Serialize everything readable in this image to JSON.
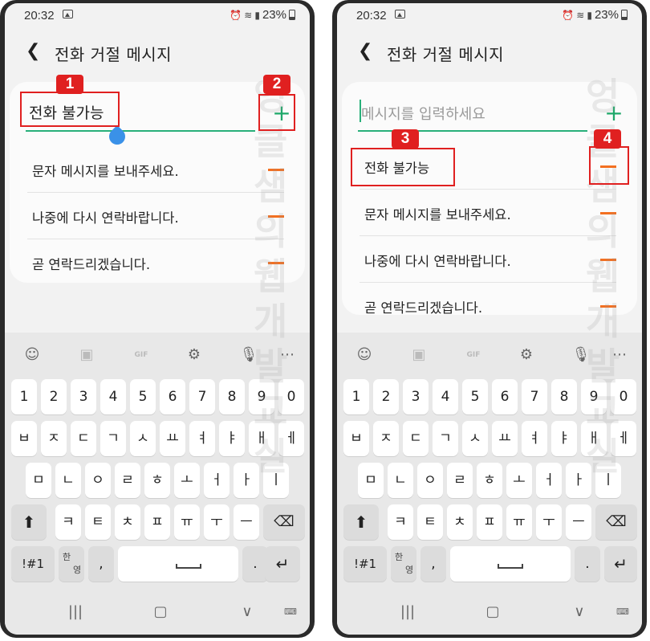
{
  "status": {
    "time": "20:32",
    "battery": "23%"
  },
  "appbar": {
    "back_icon": "chevron-left-icon",
    "title": "전화 거절 메시지"
  },
  "left": {
    "input_value": "전화 불가능",
    "messages": [
      "문자 메시지를 보내주세요.",
      "나중에 다시 연락바랍니다.",
      "곧 연락드리겠습니다."
    ]
  },
  "right": {
    "input_placeholder": "메시지를 입력하세요",
    "messages": [
      "전화 불가능",
      "문자 메시지를 보내주세요.",
      "나중에 다시 연락바랍니다.",
      "곧 연락드리겠습니다."
    ]
  },
  "badges": [
    "1",
    "2",
    "3",
    "4"
  ],
  "accent_colors": {
    "plus": "#1fa86a",
    "minus": "#f37021",
    "input_line": "#28b07a",
    "callout": "#e02020"
  },
  "keyboard": {
    "toolbar_icons": [
      "emoji-icon",
      "sticker-icon",
      "gif-icon",
      "settings-icon",
      "mic-icon",
      "more-icon"
    ],
    "gif_label": "GIF",
    "numbers": [
      "1",
      "2",
      "3",
      "4",
      "5",
      "6",
      "7",
      "8",
      "9",
      "0"
    ],
    "row1": [
      "ㅂ",
      "ㅈ",
      "ㄷ",
      "ㄱ",
      "ㅅ",
      "ㅛ",
      "ㅕ",
      "ㅑ",
      "ㅐ",
      "ㅔ"
    ],
    "row2": [
      "ㅁ",
      "ㄴ",
      "ㅇ",
      "ㄹ",
      "ㅎ",
      "ㅗ",
      "ㅓ",
      "ㅏ",
      "ㅣ"
    ],
    "row3": [
      "ㅋ",
      "ㅌ",
      "ㅊ",
      "ㅍ",
      "ㅠ",
      "ㅜ",
      "ㅡ"
    ],
    "symbols": "!#1",
    "lang_top": "한",
    "lang_bottom": "영",
    "comma": ",",
    "period": "."
  },
  "navbar_icons": [
    "recents-icon",
    "home-icon",
    "back-nav-icon",
    "keyboard-hide-icon"
  ],
  "watermark_chars": [
    "엉",
    "클",
    "샘",
    "의",
    "웹",
    "개",
    "발",
    "교",
    "실"
  ]
}
